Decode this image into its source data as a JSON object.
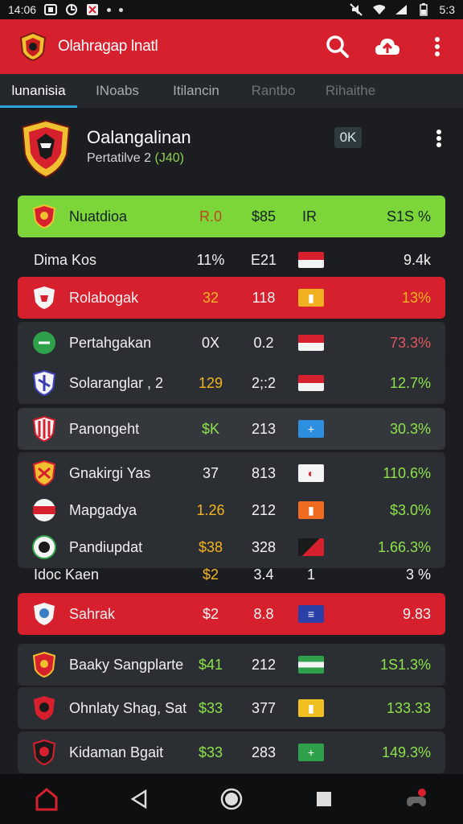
{
  "status": {
    "time": "14:06",
    "battery_time": "5:3"
  },
  "app": {
    "title": "Olahragap lnatl"
  },
  "tabs": [
    {
      "label": "lunanisia"
    },
    {
      "label": "INoabs"
    },
    {
      "label": "Itilancin"
    },
    {
      "label": "Rantbo"
    },
    {
      "label": "Rihaithe"
    }
  ],
  "team_card": {
    "name": "Oalangalinan",
    "subtitle_prefix": "Pertatilve 2",
    "subtitle_highlight": "(J40)",
    "badge": "0K"
  },
  "rows": [
    {
      "name": "Nuatdioa",
      "c1": "R.0",
      "c2": "$85",
      "c3": "IR",
      "c4": "S1S %",
      "style": "green"
    },
    {
      "name": "Dima Kos",
      "c1": "11%",
      "c2": "E21",
      "c3": "",
      "c4": "9.4k",
      "style": "plain"
    },
    {
      "name": "Rolabogak",
      "c1": "32",
      "c2": "118",
      "c3": "",
      "c4": "13%",
      "style": "red"
    },
    {
      "name": "Pertahgakan",
      "c1": "0X",
      "c2": "0.2",
      "c3": "",
      "c4": "73.3%",
      "style": "dark"
    },
    {
      "name": "Solaranglar , 2",
      "c1": "129",
      "c2": "2;:2",
      "c3": "",
      "c4": "12.7%",
      "style": "dark"
    },
    {
      "name": "Panongeht",
      "c1": "$K",
      "c2": "213",
      "c3": "",
      "c4": "30.3%",
      "style": "dark"
    },
    {
      "name": "Gnakirgi Yas",
      "c1": "37",
      "c2": "813",
      "c3": "",
      "c4": "110.6%",
      "style": "dark"
    },
    {
      "name": "Mapgadya",
      "c1": "1.26",
      "c2": "212",
      "c3": "",
      "c4": "$3.0%",
      "style": "dark"
    },
    {
      "name": "Pandiupdat",
      "c1": "$38",
      "c2": "328",
      "c3": "",
      "c4": "1.66.3%",
      "style": "dark"
    },
    {
      "name": "Idoc Kaen",
      "c1": "$2",
      "c2": "3.4",
      "c3": "1",
      "c4": "3 %",
      "style": "plain"
    },
    {
      "name": "Sahrak",
      "c1": "$2",
      "c2": "8.8",
      "c3": "",
      "c4": "9.83",
      "style": "red"
    },
    {
      "name": "Baaky Sangplarte",
      "c1": "$41",
      "c2": "212",
      "c3": "",
      "c4": "1S1.3%",
      "style": "dark"
    },
    {
      "name": "Ohnlaty Shag, Sat",
      "c1": "$33",
      "c2": "377",
      "c3": "",
      "c4": "133.33",
      "style": "dark"
    },
    {
      "name": "Kidaman Bgait",
      "c1": "$33",
      "c2": "283",
      "c3": "",
      "c4": "149.3%",
      "style": "dark"
    }
  ],
  "colors": {
    "primary": "#d6202e",
    "accent": "#2fa6d8",
    "highlight": "#7cd63a"
  },
  "icons": [
    "home-icon",
    "back-icon",
    "home-circle-icon",
    "recents-icon",
    "gamepad-icon",
    "search-icon",
    "cloud-upload-icon",
    "more-vert-icon"
  ]
}
